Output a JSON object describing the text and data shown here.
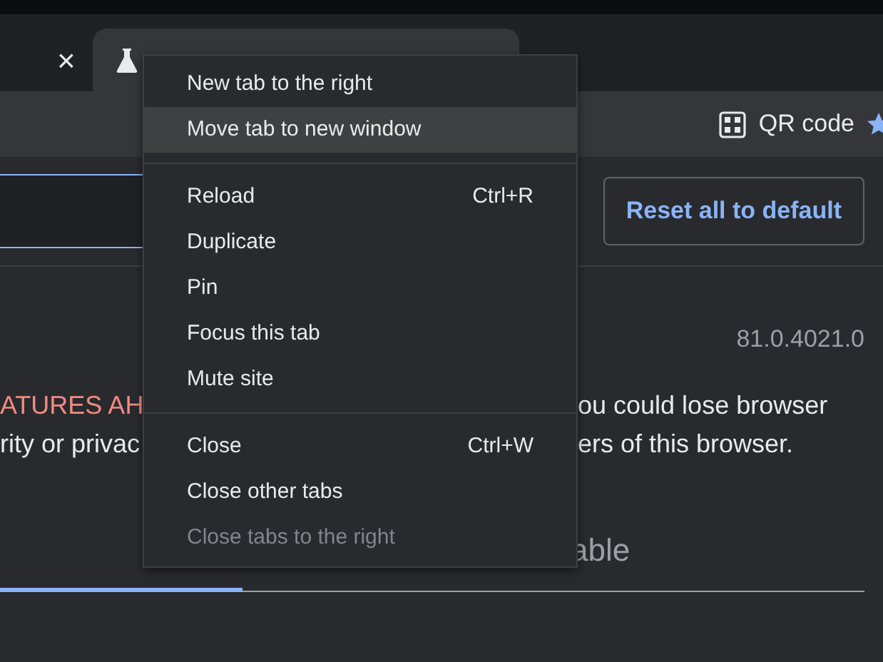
{
  "tab_strip": {
    "close_button": "×",
    "active_tab": {
      "selected": true
    }
  },
  "toolbar": {
    "qr_button": "QR code"
  },
  "page": {
    "reset_button": "Reset all to default",
    "version": "81.0.4021.0",
    "warning": {
      "heading": "ATURES AH",
      "line_1_end": "ou could lose browser",
      "line_2_start": "rity or privac",
      "line_2_end": "ers of this browser."
    },
    "tabs": [
      {
        "selected": true
      },
      {
        "label": "able",
        "selected": false
      }
    ]
  },
  "context_menu": [
    {
      "kind": "item",
      "label": "New tab to the right",
      "highlighted": false,
      "disabled": false
    },
    {
      "kind": "item",
      "label": "Move tab to new window",
      "highlighted": true,
      "disabled": false
    },
    {
      "kind": "separator"
    },
    {
      "kind": "item",
      "label": "Reload",
      "shortcut": "Ctrl+R",
      "highlighted": false,
      "disabled": false
    },
    {
      "kind": "item",
      "label": "Duplicate",
      "highlighted": false,
      "disabled": false
    },
    {
      "kind": "item",
      "label": "Pin",
      "highlighted": false,
      "disabled": false
    },
    {
      "kind": "item",
      "label": "Focus this tab",
      "highlighted": false,
      "disabled": false
    },
    {
      "kind": "item",
      "label": "Mute site",
      "highlighted": false,
      "disabled": false
    },
    {
      "kind": "separator"
    },
    {
      "kind": "item",
      "label": "Close",
      "shortcut": "Ctrl+W",
      "highlighted": false,
      "disabled": false
    },
    {
      "kind": "item",
      "label": "Close other tabs",
      "highlighted": false,
      "disabled": false
    },
    {
      "kind": "item",
      "label": "Close tabs to the right",
      "highlighted": false,
      "disabled": true
    }
  ]
}
